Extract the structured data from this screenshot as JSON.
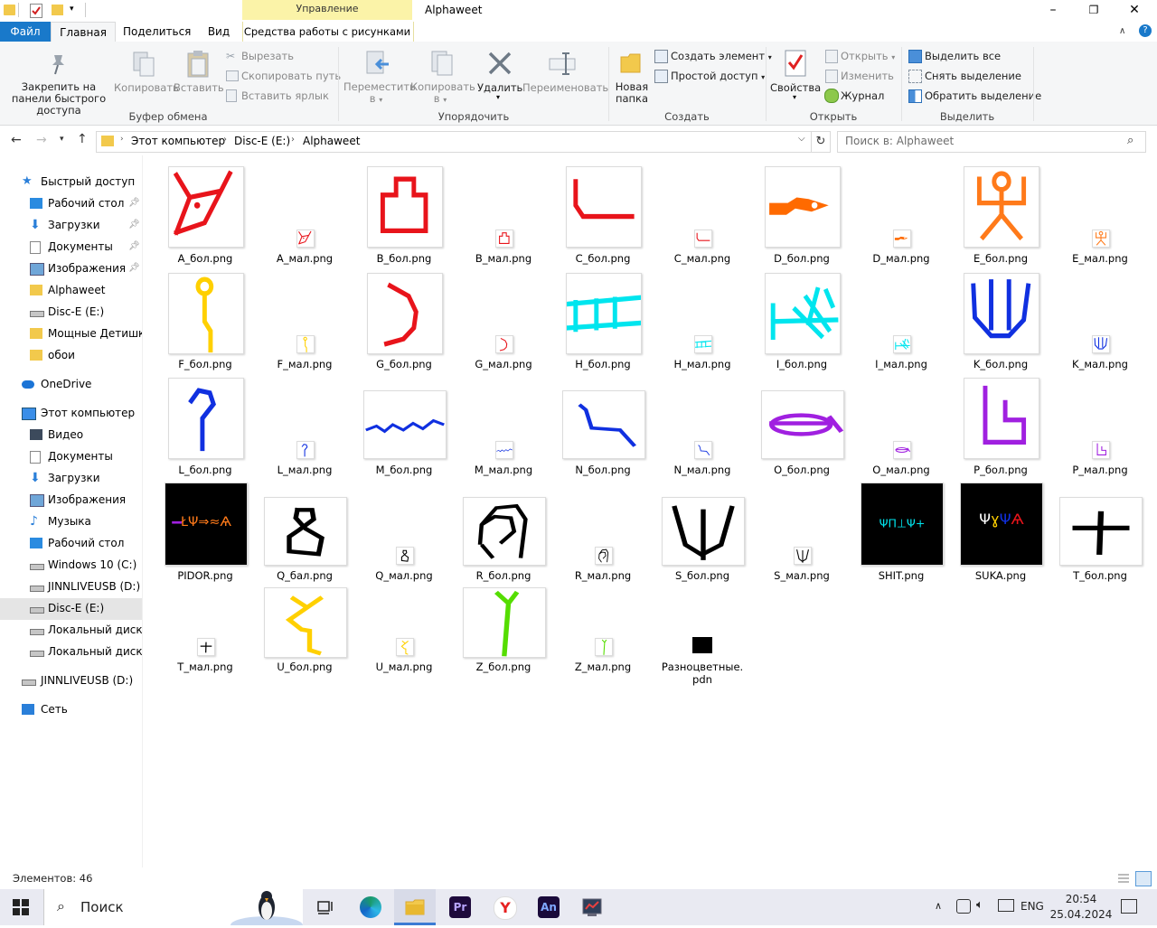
{
  "window": {
    "title": "Alphaweet",
    "context_tab_label": "Управление",
    "context_subtab_label": "Средства работы с рисунками",
    "minimize": "–",
    "maximize": "❐",
    "close": "✕"
  },
  "ribbon_tabs": [
    "Файл",
    "Главная",
    "Поделиться",
    "Вид"
  ],
  "ribbon": {
    "clipboard": {
      "pin": "Закрепить на панели быстрого доступа",
      "copy": "Копировать",
      "paste": "Вставить",
      "cut": "Вырезать",
      "copy_path": "Скопировать путь",
      "paste_shortcut": "Вставить ярлык",
      "group": "Буфер обмена"
    },
    "organize": {
      "move_to": "Переместить в",
      "copy_to": "Копировать в",
      "delete": "Удалить",
      "rename": "Переименовать",
      "group": "Упорядочить"
    },
    "new": {
      "new_folder": "Новая папка",
      "new_item": "Создать элемент",
      "easy_access": "Простой доступ",
      "group": "Создать"
    },
    "open": {
      "properties": "Свойства",
      "open": "Открыть",
      "edit": "Изменить",
      "history": "Журнал",
      "group": "Открыть"
    },
    "select": {
      "select_all": "Выделить все",
      "select_none": "Снять выделение",
      "invert": "Обратить выделение",
      "group": "Выделить"
    }
  },
  "address": {
    "crumbs": [
      "Этот компьютер",
      "Disc-E (E:)",
      "Alphaweet"
    ],
    "search_placeholder": "Поиск в: Alphaweet"
  },
  "nav": [
    {
      "label": "Быстрый доступ",
      "icon": "star-icon",
      "indent": 0,
      "pinned": false
    },
    {
      "label": "Рабочий стол",
      "icon": "desktop-icon",
      "indent": 1,
      "pinned": true
    },
    {
      "label": "Загрузки",
      "icon": "download-icon",
      "indent": 1,
      "pinned": true
    },
    {
      "label": "Документы",
      "icon": "document-icon",
      "indent": 1,
      "pinned": true
    },
    {
      "label": "Изображения",
      "icon": "pictures-icon",
      "indent": 1,
      "pinned": true
    },
    {
      "label": "Alphaweet",
      "icon": "folder-icon",
      "indent": 1,
      "pinned": false
    },
    {
      "label": "Disc-E (E:)",
      "icon": "drive-icon",
      "indent": 1,
      "pinned": false
    },
    {
      "label": "Мощные Детишки",
      "icon": "folder-icon",
      "indent": 1,
      "pinned": false
    },
    {
      "label": "обои",
      "icon": "folder-icon",
      "indent": 1,
      "pinned": false
    },
    {
      "label": "OneDrive",
      "icon": "cloud-icon",
      "indent": 0,
      "pinned": false
    },
    {
      "label": "Этот компьютер",
      "icon": "computer-icon",
      "indent": 0,
      "pinned": false
    },
    {
      "label": "Видео",
      "icon": "video-icon",
      "indent": 1,
      "pinned": false
    },
    {
      "label": "Документы",
      "icon": "document-icon",
      "indent": 1,
      "pinned": false
    },
    {
      "label": "Загрузки",
      "icon": "download-icon",
      "indent": 1,
      "pinned": false
    },
    {
      "label": "Изображения",
      "icon": "pictures-icon",
      "indent": 1,
      "pinned": false
    },
    {
      "label": "Музыка",
      "icon": "music-icon",
      "indent": 1,
      "pinned": false
    },
    {
      "label": "Рабочий стол",
      "icon": "desktop-icon",
      "indent": 1,
      "pinned": false
    },
    {
      "label": "Windows 10 (C:)",
      "icon": "drive-icon",
      "indent": 1,
      "pinned": false
    },
    {
      "label": "JINNLIVEUSB (D:)",
      "icon": "drive-icon",
      "indent": 1,
      "pinned": false
    },
    {
      "label": "Disc-E (E:)",
      "icon": "drive-icon",
      "indent": 1,
      "pinned": false,
      "selected": true
    },
    {
      "label": "Локальный диск (F",
      "icon": "drive-icon",
      "indent": 1,
      "pinned": false
    },
    {
      "label": "Локальный диск (I:",
      "icon": "drive-icon",
      "indent": 1,
      "pinned": false
    },
    {
      "label": "JINNLIVEUSB (D:)",
      "icon": "drive-icon",
      "indent": 0,
      "pinned": false
    },
    {
      "label": "Сеть",
      "icon": "network-icon",
      "indent": 0,
      "pinned": false
    }
  ],
  "files": [
    {
      "name": "A_бол.png",
      "glyph": "A",
      "color": "#e8141b",
      "size": "big",
      "bg": "#ffffff"
    },
    {
      "name": "A_мал.png",
      "glyph": "A",
      "color": "#e8141b",
      "size": "small",
      "bg": "#ffffff"
    },
    {
      "name": "B_бол.png",
      "glyph": "B",
      "color": "#e8141b",
      "size": "big",
      "bg": "#ffffff"
    },
    {
      "name": "B_мал.png",
      "glyph": "B",
      "color": "#e8141b",
      "size": "small",
      "bg": "#ffffff"
    },
    {
      "name": "C_бол.png",
      "glyph": "C",
      "color": "#e8141b",
      "size": "big",
      "bg": "#ffffff"
    },
    {
      "name": "C_мал.png",
      "glyph": "C",
      "color": "#e8141b",
      "size": "small",
      "bg": "#ffffff"
    },
    {
      "name": "D_бол.png",
      "glyph": "D",
      "color": "#ff6a00",
      "size": "big",
      "bg": "#ffffff"
    },
    {
      "name": "D_мал.png",
      "glyph": "D",
      "color": "#ff6a00",
      "size": "small",
      "bg": "#ffffff"
    },
    {
      "name": "E_бол.png",
      "glyph": "E",
      "color": "#ff7a1a",
      "size": "big",
      "bg": "#ffffff"
    },
    {
      "name": "E_мал.png",
      "glyph": "E",
      "color": "#ff7a1a",
      "size": "small",
      "bg": "#ffffff"
    },
    {
      "name": "F_бол.png",
      "glyph": "F",
      "color": "#ffd000",
      "size": "big",
      "bg": "#ffffff"
    },
    {
      "name": "F_мал.png",
      "glyph": "F",
      "color": "#ffd000",
      "size": "small",
      "bg": "#ffffff"
    },
    {
      "name": "G_бол.png",
      "glyph": "G",
      "color": "#e8141b",
      "size": "big",
      "bg": "#ffffff"
    },
    {
      "name": "G_мал.png",
      "glyph": "G",
      "color": "#e8141b",
      "size": "small",
      "bg": "#ffffff"
    },
    {
      "name": "H_бол.png",
      "glyph": "H",
      "color": "#00e5ee",
      "size": "big",
      "bg": "#ffffff"
    },
    {
      "name": "H_мал.png",
      "glyph": "H",
      "color": "#00e5ee",
      "size": "small",
      "bg": "#ffffff"
    },
    {
      "name": "I_бол.png",
      "glyph": "I",
      "color": "#00e5ee",
      "size": "big",
      "bg": "#ffffff"
    },
    {
      "name": "I_мал.png",
      "glyph": "I",
      "color": "#00e5ee",
      "size": "small",
      "bg": "#ffffff"
    },
    {
      "name": "K_бол.png",
      "glyph": "K",
      "color": "#1030e0",
      "size": "big",
      "bg": "#ffffff"
    },
    {
      "name": "K_мал.png",
      "glyph": "K",
      "color": "#1030e0",
      "size": "small",
      "bg": "#ffffff"
    },
    {
      "name": "L_бол.png",
      "glyph": "L",
      "color": "#1030e0",
      "size": "big",
      "bg": "#ffffff"
    },
    {
      "name": "L_мал.png",
      "glyph": "L",
      "color": "#1030e0",
      "size": "small",
      "bg": "#ffffff"
    },
    {
      "name": "M_бол.png",
      "glyph": "M",
      "color": "#1030e0",
      "size": "wide",
      "bg": "#ffffff"
    },
    {
      "name": "M_мал.png",
      "glyph": "M",
      "color": "#1030e0",
      "size": "small",
      "bg": "#ffffff"
    },
    {
      "name": "N_бол.png",
      "glyph": "N",
      "color": "#1030e0",
      "size": "wide",
      "bg": "#ffffff"
    },
    {
      "name": "N_мал.png",
      "glyph": "N",
      "color": "#1030e0",
      "size": "small",
      "bg": "#ffffff"
    },
    {
      "name": "O_бол.png",
      "glyph": "O",
      "color": "#a020e0",
      "size": "wide",
      "bg": "#ffffff"
    },
    {
      "name": "O_мал.png",
      "glyph": "O",
      "color": "#a020e0",
      "size": "small",
      "bg": "#ffffff"
    },
    {
      "name": "P_бол.png",
      "glyph": "P",
      "color": "#a020e0",
      "size": "big",
      "bg": "#ffffff"
    },
    {
      "name": "P_мал.png",
      "glyph": "P",
      "color": "#a020e0",
      "size": "small",
      "bg": "#ffffff"
    },
    {
      "name": "PIDOR.png",
      "glyph": "PIDOR",
      "color": "#ffffff",
      "size": "big",
      "bg": "#000000"
    },
    {
      "name": "Q_бал.png",
      "glyph": "Q",
      "color": "#000000",
      "size": "wide",
      "bg": "#ffffff"
    },
    {
      "name": "Q_мал.png",
      "glyph": "Q",
      "color": "#000000",
      "size": "small",
      "bg": "#ffffff"
    },
    {
      "name": "R_бол.png",
      "glyph": "R",
      "color": "#000000",
      "size": "wide",
      "bg": "#ffffff"
    },
    {
      "name": "R_мал.png",
      "glyph": "R",
      "color": "#000000",
      "size": "small",
      "bg": "#ffffff"
    },
    {
      "name": "S_бол.png",
      "glyph": "S",
      "color": "#000000",
      "size": "wide",
      "bg": "#ffffff"
    },
    {
      "name": "S_мал.png",
      "glyph": "S",
      "color": "#000000",
      "size": "small",
      "bg": "#ffffff"
    },
    {
      "name": "SHIT.png",
      "glyph": "SHIT",
      "color": "#ffffff",
      "size": "big",
      "bg": "#000000"
    },
    {
      "name": "SUKA.png",
      "glyph": "SUKA",
      "color": "#ffffff",
      "size": "big",
      "bg": "#000000"
    },
    {
      "name": "T_бол.png",
      "glyph": "T",
      "color": "#000000",
      "size": "wide",
      "bg": "#ffffff"
    },
    {
      "name": "T_мал.png",
      "glyph": "T",
      "color": "#000000",
      "size": "small",
      "bg": "#ffffff"
    },
    {
      "name": "U_бол.png",
      "glyph": "U",
      "color": "#ffd000",
      "size": "wide",
      "bg": "#ffffff"
    },
    {
      "name": "U_мал.png",
      "glyph": "U",
      "color": "#ffd000",
      "size": "small",
      "bg": "#ffffff"
    },
    {
      "name": "Z_бол.png",
      "glyph": "Z",
      "color": "#55dd00",
      "size": "wide",
      "bg": "#ffffff"
    },
    {
      "name": "Z_мал.png",
      "glyph": "Z",
      "color": "#55dd00",
      "size": "small",
      "bg": "#ffffff"
    },
    {
      "name": "Разноцветные.pdn",
      "glyph": "PDN",
      "color": "#000000",
      "size": "pdn",
      "bg": "#000000"
    }
  ],
  "status": {
    "item_count": "Элементов: 46"
  },
  "taskbar": {
    "search_label": "Поиск",
    "language": "ENG",
    "time": "20:54",
    "date": "25.04.2024",
    "apps": [
      "task-view-icon",
      "edge-icon",
      "file-explorer-icon",
      "premiere-icon",
      "yandex-icon",
      "animate-icon",
      "app-icon"
    ]
  }
}
